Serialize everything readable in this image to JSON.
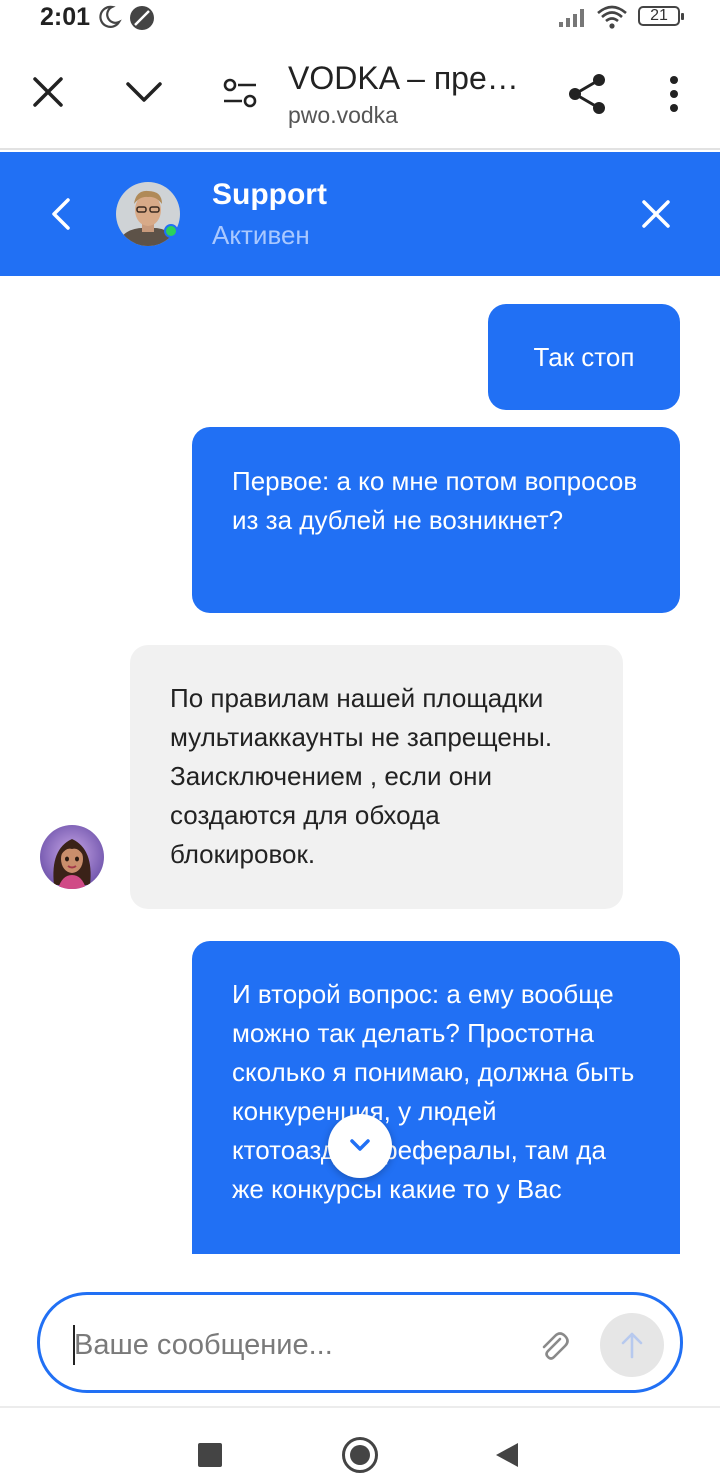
{
  "status_bar": {
    "time": "2:01",
    "battery": "21"
  },
  "browser": {
    "page_title": "VODKA – прем…",
    "url": "pwo.vodka"
  },
  "chat_header": {
    "name": "Support",
    "status": "Активен"
  },
  "messages": [
    {
      "direction": "outgoing",
      "text": "Так стоп"
    },
    {
      "direction": "outgoing",
      "text": "Первое: а ко мне потом вопросов из за дублей не возникнет?"
    },
    {
      "direction": "incoming",
      "text": "По правилам нашей площадки мультиаккаунты не запрещены. Заисключением , если они создаются для обхода блокировок."
    },
    {
      "direction": "outgoing",
      "text": "И второй вопрос: а ему вообще можно так делать? Простотна сколько я понимаю, должна быть конкуренция, у людей ктотоаздает рефералы, там да же конкурсы какие то у Вас"
    }
  ],
  "composer": {
    "placeholder": "Ваше сообщение..."
  },
  "colors": {
    "accent": "#2170f4",
    "incoming_bubble": "#f1f1f1",
    "online_dot": "#2bd15b"
  }
}
